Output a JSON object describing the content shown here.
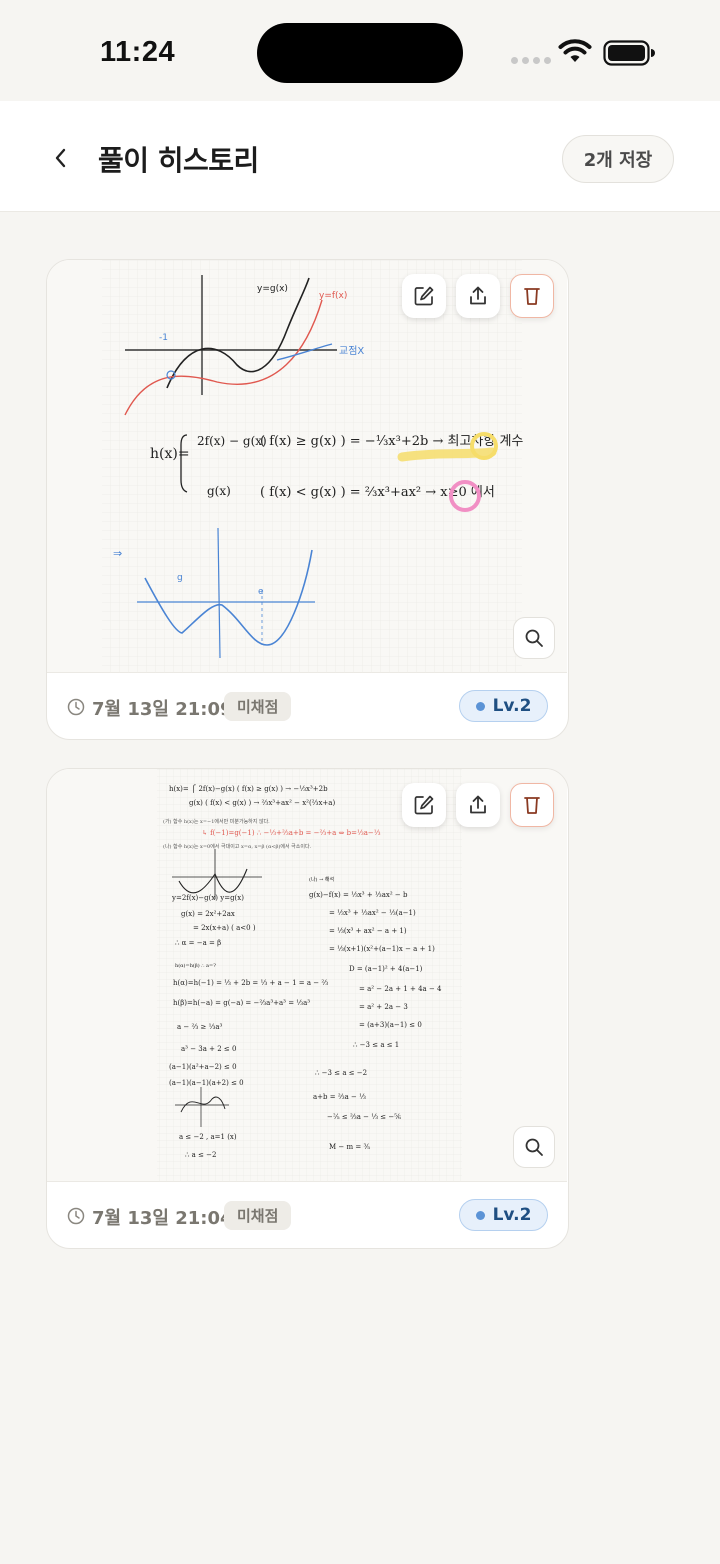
{
  "status_bar": {
    "time": "11:24"
  },
  "header": {
    "title": "풀이 히스토리",
    "count_label": "2개 저장"
  },
  "cards": [
    {
      "date": "7월 13일 21:09",
      "status": "미채점",
      "level": "Lv.2",
      "actions": [
        "edit-icon",
        "share-icon",
        "delete-icon"
      ],
      "zoom_icon": "magnifier-icon"
    },
    {
      "date": "7월 13일 21:04",
      "status": "미채점",
      "level": "Lv.2",
      "actions": [
        "edit-icon",
        "share-icon",
        "delete-icon"
      ],
      "zoom_icon": "magnifier-icon"
    }
  ],
  "colors": {
    "background": "#f6f5f2",
    "level_chip": "#e7f0fb",
    "level_text": "#1f4f82",
    "delete_border": "#f0b7a4"
  }
}
